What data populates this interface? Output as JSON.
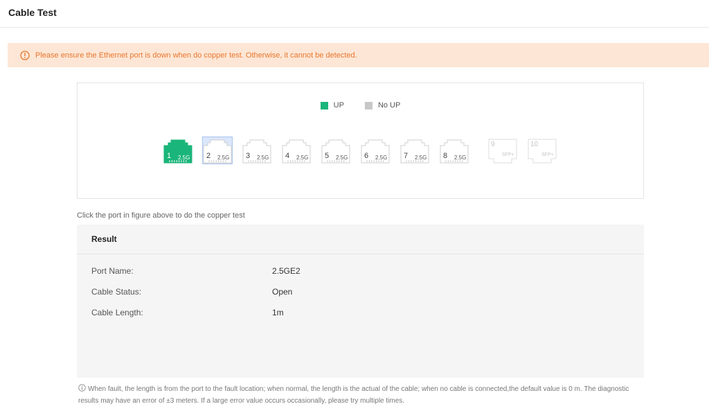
{
  "header": {
    "title": "Cable Test"
  },
  "warning": {
    "text": "Please ensure the Ethernet port is down when do copper test. Otherwise, it cannot be detected."
  },
  "legend": {
    "up_label": "UP",
    "up_color": "#1ab57a",
    "noup_label": "No UP",
    "noup_color": "#c8c8c8"
  },
  "ports": [
    {
      "number": "1",
      "speed": "2.5G",
      "status": "up",
      "selected": false
    },
    {
      "number": "2",
      "speed": "2.5G",
      "status": "no-up",
      "selected": true
    },
    {
      "number": "3",
      "speed": "2.5G",
      "status": "no-up",
      "selected": false
    },
    {
      "number": "4",
      "speed": "2.5G",
      "status": "no-up",
      "selected": false
    },
    {
      "number": "5",
      "speed": "2.5G",
      "status": "no-up",
      "selected": false
    },
    {
      "number": "6",
      "speed": "2.5G",
      "status": "no-up",
      "selected": false
    },
    {
      "number": "7",
      "speed": "2.5G",
      "status": "no-up",
      "selected": false
    },
    {
      "number": "8",
      "speed": "2.5G",
      "status": "no-up",
      "selected": false
    }
  ],
  "sfp_ports": [
    {
      "number": "9",
      "label": "SFP+"
    },
    {
      "number": "10",
      "label": "SFP+"
    }
  ],
  "hint": "Click the port in figure above to do the copper test",
  "result": {
    "title": "Result",
    "rows": [
      {
        "label": "Port Name:",
        "value": "2.5GE2"
      },
      {
        "label": "Cable Status:",
        "value": "Open"
      },
      {
        "label": "Cable Length:",
        "value": "1m"
      }
    ]
  },
  "footnote": "When fault, the length is from the port to the fault location; when normal, the length is the actual of the cable; when no cable is connected,the default value is 0 m. The diagnostic results may have an error of ±3 meters. If a large error value occurs occasionally, please try multiple times."
}
